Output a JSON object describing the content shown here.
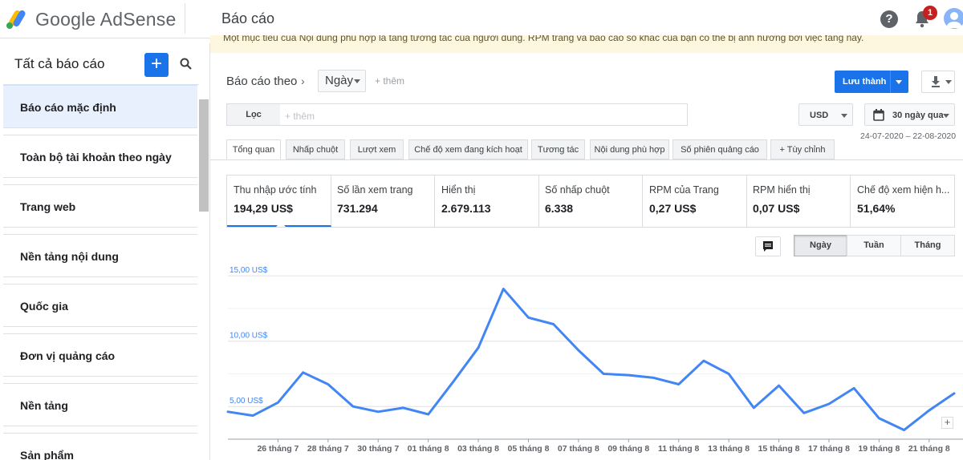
{
  "header": {
    "brand": "Google AdSense",
    "page_title": "Báo cáo",
    "notification_count": "1",
    "help_glyph": "?"
  },
  "banner": {
    "text": "Một mục tiêu của Nội dung phù hợp là tăng tương tác của người dùng. RPM trang và báo cáo số khác của bạn có thể bị ảnh hưởng bởi việc tăng này."
  },
  "sidebar": {
    "title": "Tất cả báo cáo",
    "add_glyph": "+",
    "items": [
      {
        "label": "Báo cáo mặc định"
      },
      {
        "label": "Toàn bộ tài khoản theo ngày"
      },
      {
        "label": "Trang web"
      },
      {
        "label": "Nền tảng nội dung"
      },
      {
        "label": "Quốc gia"
      },
      {
        "label": "Đơn vị quảng cáo"
      },
      {
        "label": "Nền tảng"
      },
      {
        "label": "Sản phẩm"
      }
    ]
  },
  "toolbar": {
    "report_by": "Báo cáo theo",
    "chevron": "›",
    "dimension": "Ngày",
    "add_more": "+ thêm",
    "save_label": "Lưu thành",
    "filter_label": "Lọc",
    "filter_placeholder": "+ thêm",
    "currency": "USD",
    "range": "30 ngày qua",
    "date_range": "24-07-2020 – 22-08-2020"
  },
  "tabs": [
    {
      "label": "Tổng quan"
    },
    {
      "label": "Nhấp chuột"
    },
    {
      "label": "Lượt xem"
    },
    {
      "label": "Chế độ xem đang kích hoạt"
    },
    {
      "label": "Tương tác"
    },
    {
      "label": "Nội dung phù hợp"
    },
    {
      "label": "Số phiên quảng cáo"
    },
    {
      "label": "+  Tùy chỉnh"
    }
  ],
  "metrics": [
    {
      "label": "Thu nhập ước tính",
      "value": "194,29 US$"
    },
    {
      "label": "Số lần xem trang",
      "value": "731.294"
    },
    {
      "label": "Hiển thị",
      "value": "2.679.113"
    },
    {
      "label": "Số nhấp chuột",
      "value": "6.338"
    },
    {
      "label": "RPM của Trang",
      "value": "0,27 US$"
    },
    {
      "label": "RPM hiển thị",
      "value": "0,07 US$"
    },
    {
      "label": "Chế độ xem hiện h...",
      "value": "51,64%"
    }
  ],
  "periods": [
    {
      "label": "Ngày"
    },
    {
      "label": "Tuần"
    },
    {
      "label": "Tháng"
    }
  ],
  "colors": {
    "accent": "#1a73e8",
    "line": "#4285f4",
    "axis_label": "#4285f4"
  },
  "chart_data": {
    "type": "line",
    "ylabel": "",
    "ylim": [
      2.5,
      15.5
    ],
    "ytick_labels": [
      "15,00 US$",
      "10,00 US$",
      "5,00 US$"
    ],
    "ytick_values": [
      15,
      10,
      5
    ],
    "x": [
      "24/7",
      "25/7",
      "26/7",
      "27/7",
      "28/7",
      "29/7",
      "30/7",
      "31/7",
      "01/8",
      "02/8",
      "03/8",
      "04/8",
      "05/8",
      "06/8",
      "07/8",
      "08/8",
      "09/8",
      "10/8",
      "11/8",
      "12/8",
      "13/8",
      "14/8",
      "15/8",
      "16/8",
      "17/8",
      "18/8",
      "19/8",
      "20/8",
      "21/8",
      "22/8"
    ],
    "xtick_labels": [
      "26 tháng 7",
      "28 tháng 7",
      "30 tháng 7",
      "01 tháng 8",
      "03 tháng 8",
      "05 tháng 8",
      "07 tháng 8",
      "09 tháng 8",
      "11 tháng 8",
      "13 tháng 8",
      "15 tháng 8",
      "17 tháng 8",
      "19 tháng 8",
      "21 tháng 8"
    ],
    "series": [
      {
        "values": [
          4.6,
          4.3,
          5.3,
          7.6,
          6.7,
          5.0,
          4.6,
          4.9,
          4.4,
          6.9,
          9.5,
          14.0,
          11.8,
          11.3,
          9.3,
          7.5,
          7.4,
          7.2,
          6.7,
          8.5,
          7.5,
          4.9,
          6.6,
          4.5,
          5.2,
          6.4,
          4.1,
          3.2,
          4.7,
          6.0
        ]
      }
    ]
  }
}
